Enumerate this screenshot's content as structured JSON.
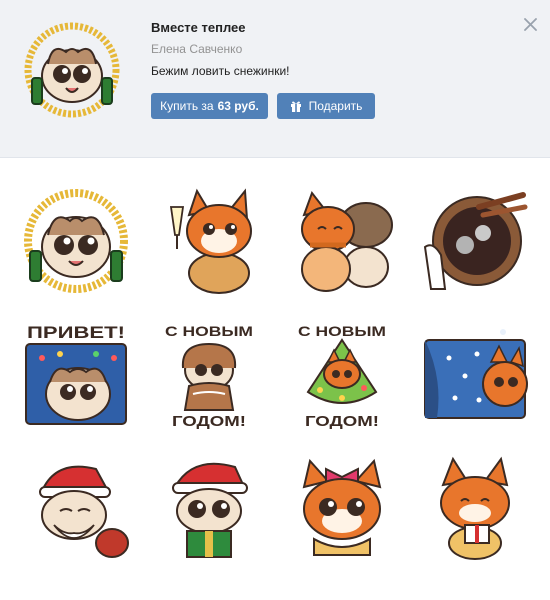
{
  "pack": {
    "title": "Вместе теплее",
    "author": "Елена Савченко",
    "description": "Бежим ловить снежинки!"
  },
  "actions": {
    "buy_label": "Купить за",
    "buy_price": "63 руб.",
    "gift_label": "Подарить"
  },
  "icons": {
    "close": "close-icon",
    "gift": "gift-icon"
  },
  "colors": {
    "accent": "#5181b8",
    "header_bg": "#f0f2f5",
    "fox_orange": "#e8762c",
    "cat_cream": "#f3e3cf"
  },
  "stickers": [
    {
      "name": "sticker-cat-champagne-tinsel"
    },
    {
      "name": "sticker-fox-champagne-glass"
    },
    {
      "name": "sticker-fox-pup-hug"
    },
    {
      "name": "sticker-mulled-wine-bowl"
    },
    {
      "name": "sticker-cat-privet",
      "text": "ПРИВЕТ!"
    },
    {
      "name": "sticker-cat-gingerbread",
      "text_top": "С НОВЫМ",
      "text_bottom": "ГОДОМ!"
    },
    {
      "name": "sticker-fox-christmas-tree",
      "text_top": "С НОВЫМ",
      "text_bottom": "ГОДОМ!"
    },
    {
      "name": "sticker-fox-window-snow"
    },
    {
      "name": "sticker-cat-santa-bag"
    },
    {
      "name": "sticker-cat-santa-gift"
    },
    {
      "name": "sticker-fox-bow"
    },
    {
      "name": "sticker-fox-present"
    }
  ]
}
